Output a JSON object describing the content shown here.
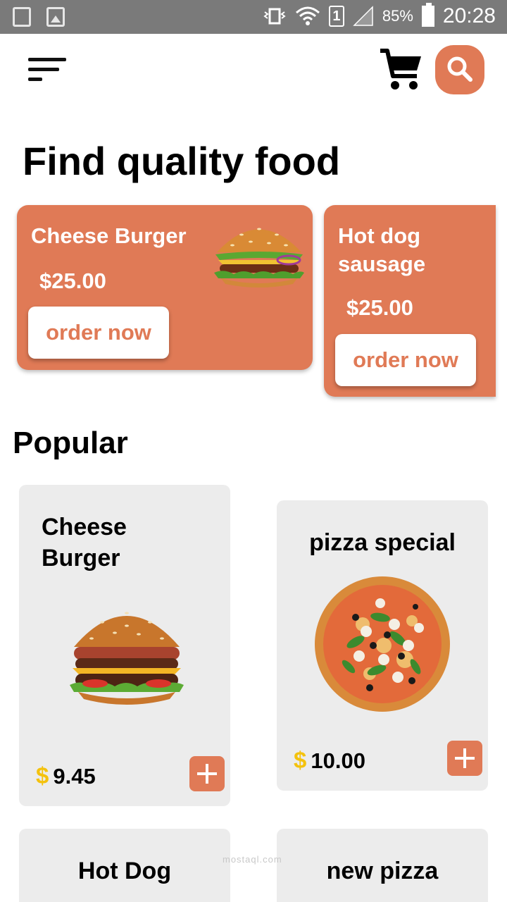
{
  "status_bar": {
    "battery": "85%",
    "time": "20:28",
    "sim_slot": "1",
    "icons": [
      "recycle-icon",
      "image-icon",
      "vibrate-icon",
      "wifi-icon",
      "sim-icon",
      "signal-icon",
      "battery-icon"
    ]
  },
  "header": {
    "menu_icon": "menu-icon",
    "cart_icon": "cart-icon",
    "search_icon": "search-icon"
  },
  "page_title": "Find quality food",
  "featured": [
    {
      "name": "Cheese Burger",
      "price": "$25.00",
      "button": "order now",
      "image": "burger-image"
    },
    {
      "name": "Hot dog sausage",
      "price": "$25.00",
      "button": "order now"
    }
  ],
  "popular": {
    "title": "Popular",
    "items": [
      {
        "name": "Cheese Burger",
        "currency": "$",
        "price": "9.45",
        "image": "burger-image"
      },
      {
        "name": "pizza special",
        "currency": "$",
        "price": "10.00",
        "image": "pizza-image"
      },
      {
        "name": "Hot Dog"
      },
      {
        "name": "new pizza"
      }
    ]
  },
  "watermark": "mostaql.com",
  "colors": {
    "accent": "#e07a56",
    "card_bg": "#ececec",
    "dollar": "#f4c20d",
    "status_bar": "#7a7a7a"
  }
}
